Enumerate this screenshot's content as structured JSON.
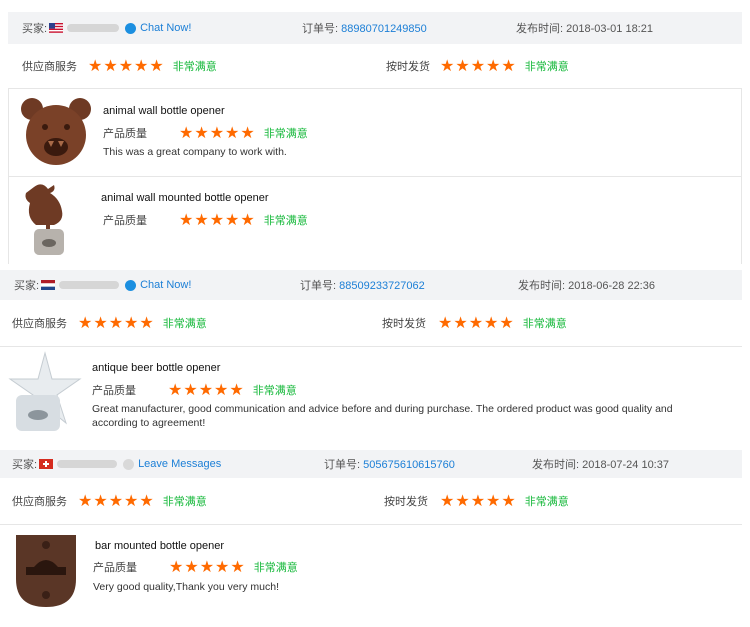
{
  "labels": {
    "buyer": "买家:",
    "order": "订单号:",
    "posted": "发布时间:",
    "supplier_service": "供应商服务",
    "on_time_delivery": "按时发货",
    "product_quality": "产品质量",
    "very_satisfied": "非常满意",
    "stars": "★★★★★"
  },
  "reviews": [
    {
      "chat_label": "Chat Now!",
      "order_no": "88980701249850",
      "posted_at": "2018-03-01 18:21",
      "flag": "us",
      "products": [
        {
          "name": "animal wall bottle opener",
          "comment": "This was a great company to work with.",
          "image": "bear-head-bottle-opener"
        },
        {
          "name": "animal wall mounted bottle opener",
          "comment": "",
          "image": "rooster-bottle-opener"
        }
      ]
    },
    {
      "chat_label": "Chat Now!",
      "order_no": "88509233727062",
      "posted_at": "2018-06-28 22:36",
      "flag": "nl",
      "products": [
        {
          "name": "antique beer bottle opener",
          "comment": "Great manufacturer, good communication and advice before and during purchase. The ordered product was good quality and according to agreement!",
          "image": "starfish-bottle-opener"
        }
      ]
    },
    {
      "chat_label": "Leave Messages",
      "order_no": "505675610615760",
      "posted_at": "2018-07-24 10:37",
      "flag": "ch",
      "products": [
        {
          "name": "bar mounted bottle opener",
          "comment": "Very good quality,Thank you very much!",
          "image": "wall-mount-bottle-opener"
        }
      ]
    }
  ],
  "colors": {
    "accent_link": "#1c7fd6",
    "star": "#ff6a00",
    "satisfied": "#15b83a",
    "header_bg": "#f2f3f5"
  }
}
